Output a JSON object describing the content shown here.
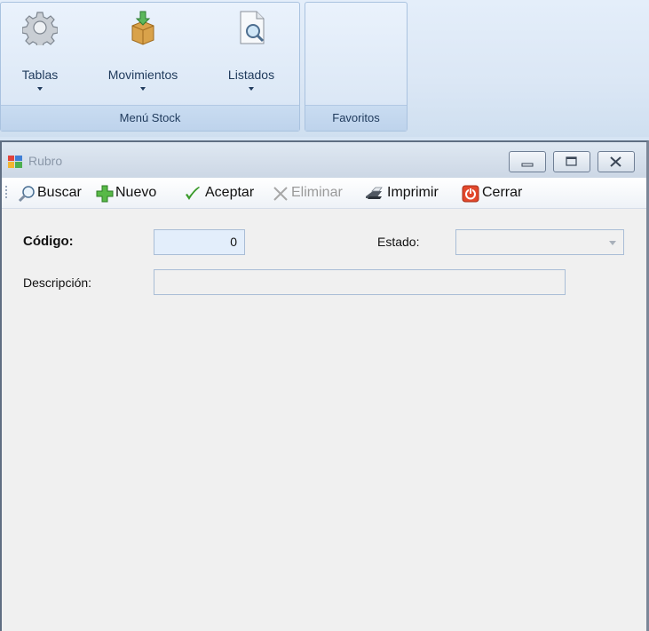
{
  "ribbon": {
    "groups": [
      {
        "label": "Menú Stock"
      },
      {
        "label": "Favoritos"
      }
    ],
    "buttons": [
      {
        "label": "Tablas",
        "icon": "gear-icon"
      },
      {
        "label": "Movimientos",
        "icon": "box-download-icon"
      },
      {
        "label": "Listados",
        "icon": "document-search-icon"
      }
    ]
  },
  "window": {
    "title": "Rubro",
    "controls": [
      "minimize",
      "restore",
      "close"
    ]
  },
  "toolbar": {
    "buscar": "Buscar",
    "nuevo": "Nuevo",
    "aceptar": "Aceptar",
    "eliminar": "Eliminar",
    "imprimir": "Imprimir",
    "cerrar": "Cerrar"
  },
  "form": {
    "codigo_label": "Código:",
    "codigo_value": "0",
    "estado_label": "Estado:",
    "estado_value": "",
    "descripcion_label": "Descripción:",
    "descripcion_value": ""
  },
  "colors": {
    "ribbon_bg": "#dbe7f5",
    "ribbon_text": "#1e395b",
    "window_bg": "#f0f0f0",
    "active_field": "#e3eefb"
  }
}
